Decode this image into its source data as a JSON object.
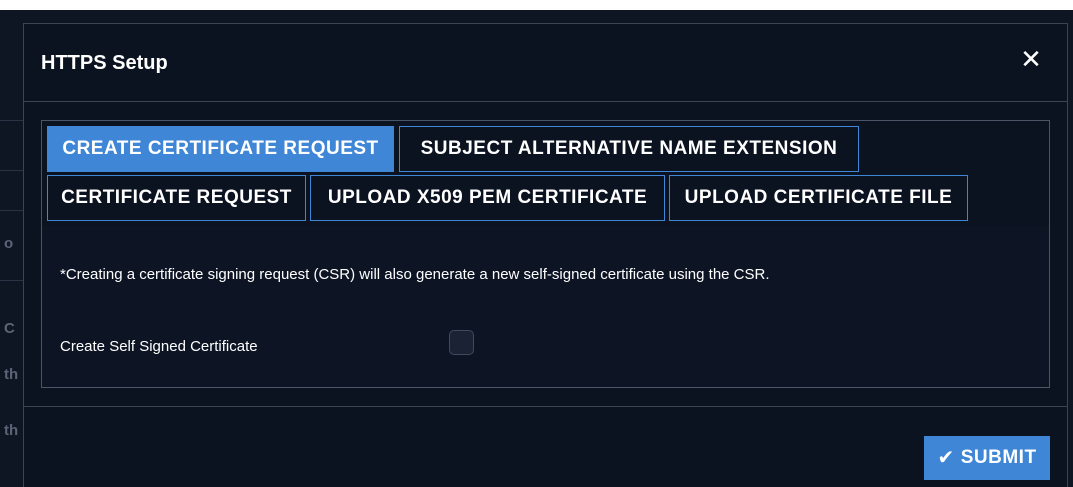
{
  "modal": {
    "title": "HTTPS Setup",
    "close_icon": "close-icon"
  },
  "tabs": [
    {
      "label": "CREATE CERTIFICATE REQUEST",
      "active": true
    },
    {
      "label": "SUBJECT ALTERNATIVE NAME EXTENSION",
      "active": false
    },
    {
      "label": "CERTIFICATE REQUEST",
      "active": false
    },
    {
      "label": "UPLOAD X509 PEM CERTIFICATE",
      "active": false
    },
    {
      "label": "UPLOAD CERTIFICATE FILE",
      "active": false
    }
  ],
  "panel": {
    "note": "*Creating a certificate signing request (CSR) will also generate a new self-signed certificate using the CSR.",
    "self_signed_label": "Create Self Signed Certificate",
    "self_signed_checked": false
  },
  "footer": {
    "submit_label": "SUBMIT",
    "submit_icon": "checkmark-icon"
  },
  "background_fragments": [
    "o",
    "C",
    "th",
    "th"
  ],
  "colors": {
    "accent": "#3f86d6",
    "modal_bg": "#0b1220",
    "panel_bg": "#0d1424",
    "text": "#ffffff"
  }
}
